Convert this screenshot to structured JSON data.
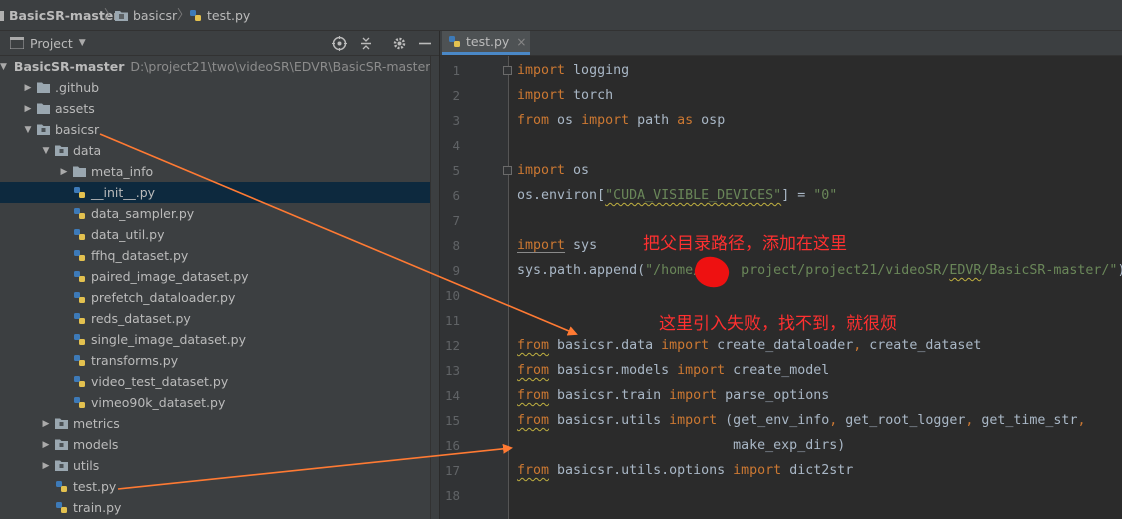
{
  "breadcrumb": [
    {
      "label": "BasicSR-master",
      "icon": "folder-icon"
    },
    {
      "label": "basicsr",
      "icon": "folder-icon"
    },
    {
      "label": "test.py",
      "icon": "python-file-icon"
    }
  ],
  "project_panel": {
    "title": "Project",
    "tools": [
      "target-icon",
      "collapse-icon",
      "gear-icon",
      "minimize-icon"
    ],
    "tree": [
      {
        "depth": 0,
        "type": "folder",
        "expanded": true,
        "label": "BasicSR-master",
        "path": "D:\\project21\\two\\videoSR\\EDVR\\BasicSR-master",
        "bold": true
      },
      {
        "depth": 1,
        "type": "folder",
        "expanded": false,
        "label": ".github"
      },
      {
        "depth": 1,
        "type": "folder",
        "expanded": false,
        "label": "assets"
      },
      {
        "depth": 1,
        "type": "package",
        "expanded": true,
        "label": "basicsr"
      },
      {
        "depth": 2,
        "type": "package",
        "expanded": true,
        "label": "data"
      },
      {
        "depth": 3,
        "type": "folder",
        "expanded": false,
        "label": "meta_info"
      },
      {
        "depth": 3,
        "type": "python",
        "label": "__init__.py",
        "selected": true
      },
      {
        "depth": 3,
        "type": "python",
        "label": "data_sampler.py"
      },
      {
        "depth": 3,
        "type": "python",
        "label": "data_util.py"
      },
      {
        "depth": 3,
        "type": "python",
        "label": "ffhq_dataset.py"
      },
      {
        "depth": 3,
        "type": "python",
        "label": "paired_image_dataset.py"
      },
      {
        "depth": 3,
        "type": "python",
        "label": "prefetch_dataloader.py"
      },
      {
        "depth": 3,
        "type": "python",
        "label": "reds_dataset.py"
      },
      {
        "depth": 3,
        "type": "python",
        "label": "single_image_dataset.py"
      },
      {
        "depth": 3,
        "type": "python",
        "label": "transforms.py"
      },
      {
        "depth": 3,
        "type": "python",
        "label": "video_test_dataset.py"
      },
      {
        "depth": 3,
        "type": "python",
        "label": "vimeo90k_dataset.py"
      },
      {
        "depth": 2,
        "type": "package",
        "expanded": false,
        "label": "metrics"
      },
      {
        "depth": 2,
        "type": "package",
        "expanded": false,
        "label": "models"
      },
      {
        "depth": 2,
        "type": "package",
        "expanded": false,
        "label": "utils"
      },
      {
        "depth": 2,
        "type": "python",
        "label": "test.py"
      },
      {
        "depth": 2,
        "type": "python",
        "label": "train.py"
      }
    ]
  },
  "editor": {
    "tab": {
      "label": "test.py",
      "close": "×"
    },
    "lines": [
      {
        "n": "1",
        "tokens": [
          {
            "t": "import",
            "c": "kw"
          },
          {
            "t": " logging"
          }
        ],
        "fold": true
      },
      {
        "n": "2",
        "tokens": [
          {
            "t": "import",
            "c": "kw"
          },
          {
            "t": " torch"
          }
        ]
      },
      {
        "n": "3",
        "tokens": [
          {
            "t": "from",
            "c": "kw"
          },
          {
            "t": " os "
          },
          {
            "t": "import",
            "c": "kw"
          },
          {
            "t": " path "
          },
          {
            "t": "as",
            "c": "kw"
          },
          {
            "t": " osp"
          }
        ]
      },
      {
        "n": "4",
        "tokens": []
      },
      {
        "n": "5",
        "tokens": [
          {
            "t": "import",
            "c": "kw"
          },
          {
            "t": " os"
          }
        ],
        "fold": true
      },
      {
        "n": "6",
        "tokens": [
          {
            "t": "os.environ["
          },
          {
            "t": "\"CUDA_VISIBLE_DEVICES\"",
            "c": "str wavy"
          },
          {
            "t": "] = "
          },
          {
            "t": "\"0\"",
            "c": "str"
          }
        ]
      },
      {
        "n": "7",
        "tokens": []
      },
      {
        "n": "8",
        "tokens": [
          {
            "t": "import",
            "c": "kw ul"
          },
          {
            "t": " sys"
          }
        ]
      },
      {
        "n": "9",
        "tokens": [
          {
            "t": "sys.path.append("
          },
          {
            "t": "\"/home/     project/project21/videoSR/",
            "c": "str"
          },
          {
            "t": "EDVR",
            "c": "str wavy"
          },
          {
            "t": "/BasicSR-master/\"",
            "c": "str"
          },
          {
            "t": ")"
          }
        ]
      },
      {
        "n": "10",
        "tokens": []
      },
      {
        "n": "11",
        "tokens": []
      },
      {
        "n": "12",
        "tokens": [
          {
            "t": "from",
            "c": "kw wavy"
          },
          {
            "t": " basicsr.data "
          },
          {
            "t": "import",
            "c": "kw"
          },
          {
            "t": " create_dataloader"
          },
          {
            "t": ",",
            "c": "kw"
          },
          {
            "t": " create_dataset"
          }
        ]
      },
      {
        "n": "13",
        "tokens": [
          {
            "t": "from",
            "c": "kw wavy"
          },
          {
            "t": " basicsr.models "
          },
          {
            "t": "import",
            "c": "kw"
          },
          {
            "t": " create_model"
          }
        ]
      },
      {
        "n": "14",
        "tokens": [
          {
            "t": "from",
            "c": "kw wavy"
          },
          {
            "t": " basicsr.train "
          },
          {
            "t": "import",
            "c": "kw"
          },
          {
            "t": " parse_options"
          }
        ]
      },
      {
        "n": "15",
        "tokens": [
          {
            "t": "from",
            "c": "kw wavy"
          },
          {
            "t": " basicsr.utils "
          },
          {
            "t": "import",
            "c": "kw"
          },
          {
            "t": " (get_env_info"
          },
          {
            "t": ",",
            "c": "kw"
          },
          {
            "t": " get_root_logger"
          },
          {
            "t": ",",
            "c": "kw"
          },
          {
            "t": " get_time_str"
          },
          {
            "t": ",",
            "c": "kw"
          }
        ]
      },
      {
        "n": "16",
        "tokens": [
          {
            "t": "                           make_exp_dirs)"
          }
        ]
      },
      {
        "n": "17",
        "tokens": [
          {
            "t": "from",
            "c": "kw wavy"
          },
          {
            "t": " basicsr.utils.options "
          },
          {
            "t": "import",
            "c": "kw"
          },
          {
            "t": " dict2str"
          }
        ]
      },
      {
        "n": "18",
        "tokens": []
      }
    ]
  },
  "annotations": {
    "note1": "把父目录路径，添加在这里",
    "note2": "这里引入失败，找不到，就很烦",
    "arrow_color": "#ff7a33",
    "text_color": "#ff3030"
  },
  "colors": {
    "keyword": "#cc7832",
    "string": "#6a8759",
    "text": "#a9b7c6",
    "selection": "#0d293e",
    "tab_underline": "#4a88c7"
  }
}
